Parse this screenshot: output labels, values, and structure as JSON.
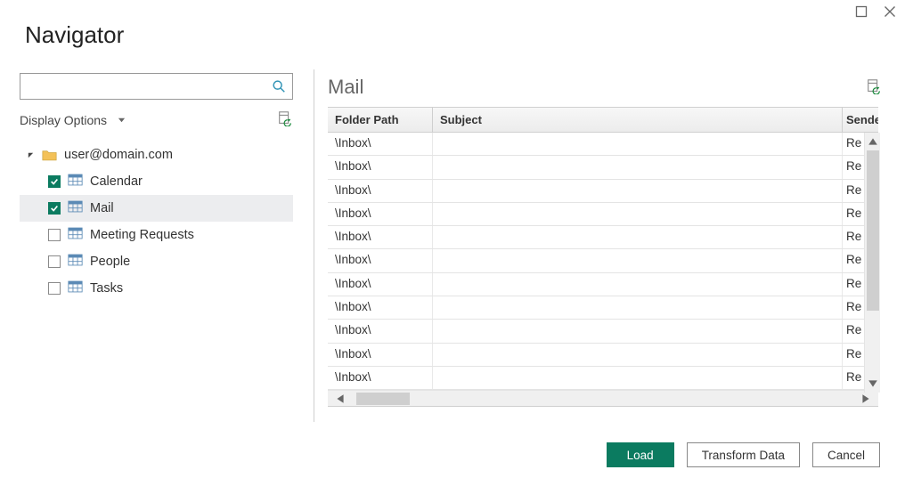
{
  "window": {
    "title": "Navigator"
  },
  "search": {
    "value": "",
    "placeholder": ""
  },
  "display_options_label": "Display Options",
  "tree": {
    "root": {
      "label": "user@domain.com",
      "expanded": true
    },
    "items": [
      {
        "label": "Calendar",
        "checked": true,
        "selected": false
      },
      {
        "label": "Mail",
        "checked": true,
        "selected": true
      },
      {
        "label": "Meeting Requests",
        "checked": false,
        "selected": false
      },
      {
        "label": "People",
        "checked": false,
        "selected": false
      },
      {
        "label": "Tasks",
        "checked": false,
        "selected": false
      }
    ]
  },
  "preview": {
    "title": "Mail",
    "columns": [
      "Folder Path",
      "Subject",
      "Sende"
    ],
    "rows": [
      {
        "folder": "\\Inbox\\",
        "subject": "",
        "sender": "Re"
      },
      {
        "folder": "\\Inbox\\",
        "subject": "",
        "sender": "Re"
      },
      {
        "folder": "\\Inbox\\",
        "subject": "",
        "sender": "Re"
      },
      {
        "folder": "\\Inbox\\",
        "subject": "",
        "sender": "Re"
      },
      {
        "folder": "\\Inbox\\",
        "subject": "",
        "sender": "Re"
      },
      {
        "folder": "\\Inbox\\",
        "subject": "",
        "sender": "Re"
      },
      {
        "folder": "\\Inbox\\",
        "subject": "",
        "sender": "Re"
      },
      {
        "folder": "\\Inbox\\",
        "subject": "",
        "sender": "Re"
      },
      {
        "folder": "\\Inbox\\",
        "subject": "",
        "sender": "Re"
      },
      {
        "folder": "\\Inbox\\",
        "subject": "",
        "sender": "Re"
      },
      {
        "folder": "\\Inbox\\",
        "subject": "",
        "sender": "Re"
      }
    ]
  },
  "buttons": {
    "load": "Load",
    "transform": "Transform Data",
    "cancel": "Cancel"
  }
}
